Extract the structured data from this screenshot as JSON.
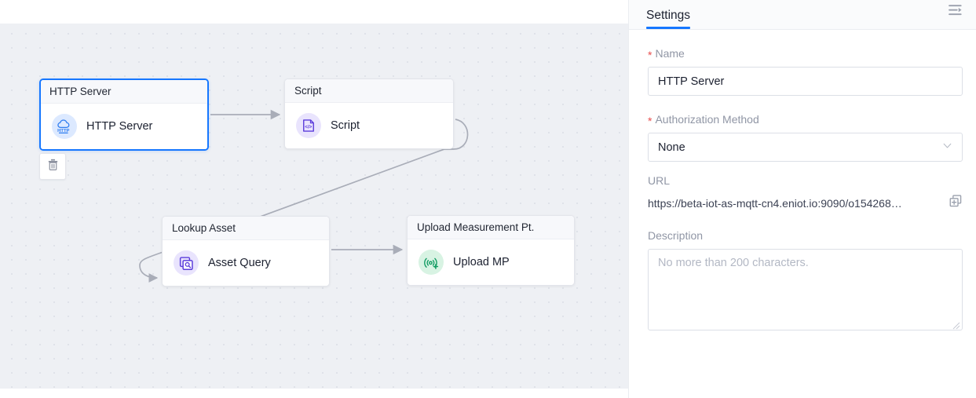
{
  "canvas": {
    "delete_button_icon": "trash-icon",
    "nodes": [
      {
        "id": "http-server",
        "title": "HTTP Server",
        "label": "HTTP Server",
        "icon": "http-cloud-icon",
        "icon_color": "#2e7df0",
        "icon_bg": "#dce9ff",
        "selected": true
      },
      {
        "id": "script",
        "title": "Script",
        "label": "Script",
        "icon": "code-file-icon",
        "icon_color": "#5b3cdb",
        "icon_bg": "#e9e4fd",
        "selected": false
      },
      {
        "id": "lookup-asset",
        "title": "Lookup Asset",
        "label": "Asset Query",
        "icon": "asset-query-icon",
        "icon_color": "#5b3cdb",
        "icon_bg": "#e9e4fd",
        "selected": false
      },
      {
        "id": "upload-measurement-pt",
        "title": "Upload Measurement Pt.",
        "label": "Upload MP",
        "icon": "signal-upload-icon",
        "icon_color": "#129c63",
        "icon_bg": "#d8f3e3",
        "selected": false
      }
    ],
    "edge_color": "#a9adb8"
  },
  "panel": {
    "tab_label": "Settings",
    "collapse_icon": "collapse-panel-icon",
    "accent_color": "#1677ff",
    "fields": {
      "name": {
        "label": "Name",
        "required": true,
        "value": "HTTP Server"
      },
      "authorization_method": {
        "label": "Authorization Method",
        "required": true,
        "value": "None",
        "chevron_icon": "chevron-down-icon"
      },
      "url": {
        "label": "URL",
        "required": false,
        "value": "https://beta-iot-as-mqtt-cn4.eniot.io:9090/o154268…",
        "copy_icon": "copy-icon"
      },
      "description": {
        "label": "Description",
        "required": false,
        "value": "",
        "placeholder": "No more than 200 characters."
      }
    }
  }
}
